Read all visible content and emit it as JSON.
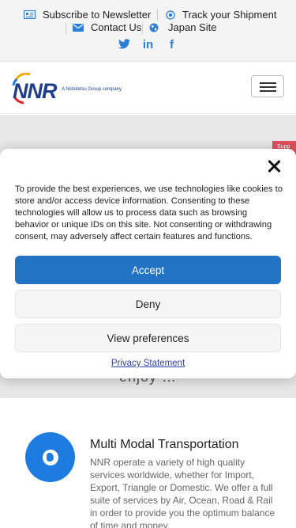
{
  "topbar": {
    "subscribe": {
      "label": "Subscribe to Newsletter",
      "icon": "newsletter-icon"
    },
    "track": {
      "label": "Track your Shipment",
      "icon": "location-icon"
    },
    "contact": {
      "label": "Contact Us",
      "icon": "mail-icon"
    },
    "japan": {
      "label": "Japan Site",
      "icon": "globe-icon"
    },
    "social": [
      {
        "name": "twitter",
        "glyph": "🐦"
      },
      {
        "name": "linkedin",
        "glyph": "in"
      },
      {
        "name": "facebook",
        "glyph": "f"
      }
    ]
  },
  "header": {
    "logo_text": "NNR",
    "logo_tagline": "A Nishitetsu Group company"
  },
  "background": {
    "support_tab": "Supp",
    "hero_text": "enjoy …"
  },
  "service": {
    "title": "Multi Modal Transportation",
    "description": "NNR operate a variety of high quality services worldwide, whether for Import, Export, Triangle or Domestic. We offer a full suite of services by Air, Ocean, Road & Rail in order to provide you the optimum balance of time and money."
  },
  "consent": {
    "message": "To provide the best experiences, we use technologies like cookies to store and/or access device information. Consenting to these technologies will allow us to process data such as browsing behavior or unique IDs on this site. Not consenting or withdrawing consent, may adversely affect certain features and functions.",
    "accept_label": "Accept",
    "deny_label": "Deny",
    "preferences_label": "View preferences",
    "privacy_label": "Privacy Statement"
  },
  "colors": {
    "accent": "#2273c3",
    "icon_blue": "#2b7fd4",
    "brand_navy": "#1f3d8a"
  }
}
